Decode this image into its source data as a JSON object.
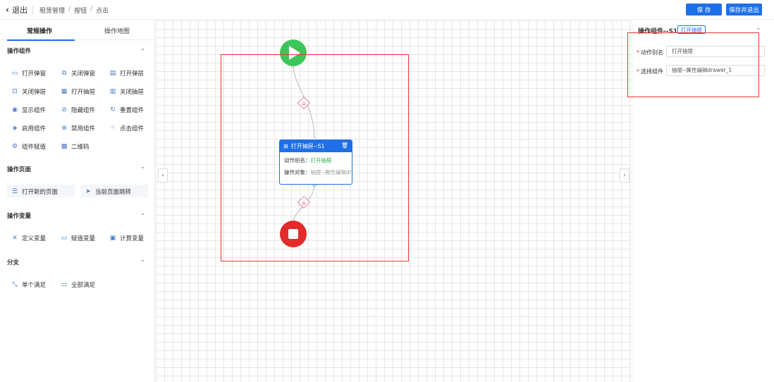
{
  "topbar": {
    "back_label": "退出",
    "breadcrumb": [
      "租赁管理",
      "按钮",
      "点击"
    ],
    "separator": "/",
    "save_label": "保 存",
    "save_exit_label": "保存并退出"
  },
  "left_panel": {
    "tabs": [
      {
        "label": "常规操作",
        "active": true
      },
      {
        "label": "操作地图",
        "active": false
      }
    ],
    "sections": [
      {
        "title": "操作组件",
        "items": [
          {
            "label": "打开弹窗",
            "icon": "window-icon"
          },
          {
            "label": "关闭弹窗",
            "icon": "close-window-icon"
          },
          {
            "label": "打开弹层",
            "icon": "layer-icon"
          },
          {
            "label": "关闭弹层",
            "icon": "close-layer-icon"
          },
          {
            "label": "打开抽屉",
            "icon": "drawer-icon"
          },
          {
            "label": "关闭抽屉",
            "icon": "close-drawer-icon"
          },
          {
            "label": "显示组件",
            "icon": "eye-icon"
          },
          {
            "label": "隐藏组件",
            "icon": "eye-off-icon"
          },
          {
            "label": "重置组件",
            "icon": "reset-icon"
          },
          {
            "label": "启用组件",
            "icon": "cube-icon"
          },
          {
            "label": "禁用组件",
            "icon": "ban-icon"
          },
          {
            "label": "点击组件",
            "icon": "click-icon"
          },
          {
            "label": "组件赋值",
            "icon": "assign-icon"
          },
          {
            "label": "二维码",
            "icon": "qrcode-icon"
          }
        ]
      },
      {
        "title": "操作页面",
        "items": [
          {
            "label": "打开新的页面",
            "icon": "page-icon"
          },
          {
            "label": "当前页面跳转",
            "icon": "send-icon"
          }
        ]
      },
      {
        "title": "操作变量",
        "items": [
          {
            "label": "定义变量",
            "icon": "variable-icon"
          },
          {
            "label": "赋值变量",
            "icon": "assign-var-icon"
          },
          {
            "label": "计算变量",
            "icon": "calculator-icon"
          }
        ]
      },
      {
        "title": "分支",
        "items": [
          {
            "label": "单个满足",
            "icon": "branch-icon"
          },
          {
            "label": "全部满足",
            "icon": "tree-icon"
          }
        ]
      }
    ]
  },
  "canvas": {
    "node": {
      "title": "打开抽屉--S1",
      "alias_key": "动作别名：",
      "alias_value": "打开抽屉",
      "target_key": "操作对象：",
      "target_value": "抽屉--属性编辑dr..."
    },
    "colors": {
      "start": "#3cc65a",
      "end": "#e32b2b",
      "accent": "#1f6fe8",
      "highlight": "#e33333"
    }
  },
  "right_panel": {
    "title": "操作组件--S1",
    "tag": "打开抽屉",
    "fields": [
      {
        "label": "动作别名",
        "value": "打开抽屉",
        "required": true
      },
      {
        "label": "选择组件",
        "value": "抽屉--属性编辑drawer_1",
        "required": true
      }
    ]
  }
}
